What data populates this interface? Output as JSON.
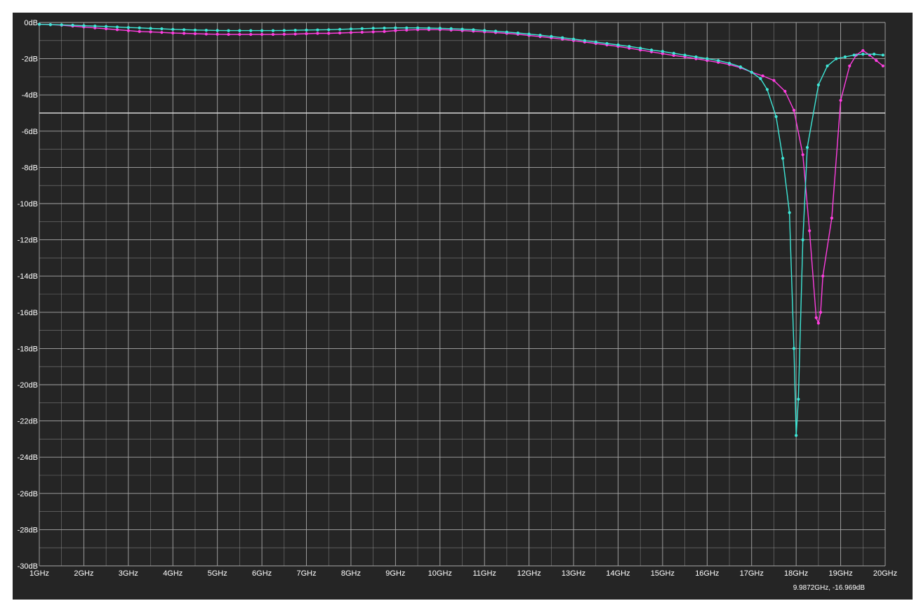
{
  "chart_data": {
    "type": "line",
    "title": "",
    "xlabel": "",
    "ylabel": "",
    "x_unit": "GHz",
    "y_unit": "dB",
    "xlim": [
      1,
      20
    ],
    "ylim": [
      -30,
      0
    ],
    "x_ticks": [
      1,
      2,
      3,
      4,
      5,
      6,
      7,
      8,
      9,
      10,
      11,
      12,
      13,
      14,
      15,
      16,
      17,
      18,
      19,
      20
    ],
    "x_tick_labels": [
      "1GHz",
      "2GHz",
      "3GHz",
      "4GHz",
      "5GHz",
      "6GHz",
      "7GHz",
      "8GHz",
      "9GHz",
      "10GHz",
      "11GHz",
      "12GHz",
      "13GHz",
      "14GHz",
      "15GHz",
      "16GHz",
      "17GHz",
      "18GHz",
      "19GHz",
      "20GHz"
    ],
    "y_ticks": [
      0,
      -2,
      -4,
      -6,
      -8,
      -10,
      -12,
      -14,
      -16,
      -18,
      -20,
      -22,
      -24,
      -26,
      -28,
      -30
    ],
    "y_tick_labels": [
      "0dB",
      "-2dB",
      "-4dB",
      "-6dB",
      "-8dB",
      "-10dB",
      "-12dB",
      "-14dB",
      "-16dB",
      "-18dB",
      "-20dB",
      "-22dB",
      "-24dB",
      "-26dB",
      "-28dB",
      "-30dB"
    ],
    "grid": true,
    "legend": "none",
    "background_color": "#252525",
    "grid_color": "#a8a8a8",
    "cursor_readout": "9.9872GHz, -16.969dB",
    "series": [
      {
        "color": "#ff3ee0",
        "x": [
          1.0,
          1.25,
          1.5,
          1.75,
          2.0,
          2.25,
          2.5,
          2.75,
          3.0,
          3.25,
          3.5,
          3.75,
          4.0,
          4.25,
          4.5,
          4.75,
          5.0,
          5.25,
          5.5,
          5.75,
          6.0,
          6.25,
          6.5,
          6.75,
          7.0,
          7.25,
          7.5,
          7.75,
          8.0,
          8.25,
          8.5,
          8.75,
          9.0,
          9.25,
          9.5,
          9.75,
          10.0,
          10.25,
          10.5,
          10.75,
          11.0,
          11.25,
          11.5,
          11.75,
          12.0,
          12.25,
          12.5,
          12.75,
          13.0,
          13.25,
          13.5,
          13.75,
          14.0,
          14.25,
          14.5,
          14.75,
          15.0,
          15.25,
          15.5,
          15.75,
          16.0,
          16.25,
          16.5,
          16.75,
          17.0,
          17.25,
          17.5,
          17.75,
          17.95,
          18.15,
          18.3,
          18.45,
          18.5,
          18.55,
          18.6,
          18.8,
          19.0,
          19.2,
          19.35,
          19.5,
          19.65,
          19.8,
          19.95
        ],
        "y": [
          -0.1,
          -0.12,
          -0.15,
          -0.2,
          -0.25,
          -0.3,
          -0.35,
          -0.4,
          -0.45,
          -0.5,
          -0.52,
          -0.55,
          -0.58,
          -0.6,
          -0.62,
          -0.64,
          -0.65,
          -0.66,
          -0.66,
          -0.66,
          -0.66,
          -0.66,
          -0.65,
          -0.64,
          -0.62,
          -0.6,
          -0.6,
          -0.58,
          -0.56,
          -0.54,
          -0.52,
          -0.5,
          -0.45,
          -0.42,
          -0.4,
          -0.4,
          -0.4,
          -0.42,
          -0.45,
          -0.48,
          -0.52,
          -0.56,
          -0.6,
          -0.65,
          -0.72,
          -0.78,
          -0.85,
          -0.92,
          -1.0,
          -1.08,
          -1.16,
          -1.24,
          -1.32,
          -1.42,
          -1.52,
          -1.62,
          -1.72,
          -1.82,
          -1.9,
          -2.0,
          -2.1,
          -2.2,
          -2.32,
          -2.5,
          -2.75,
          -2.95,
          -3.2,
          -3.8,
          -4.85,
          -7.3,
          -11.5,
          -16.3,
          -16.6,
          -16.0,
          -14.0,
          -10.8,
          -4.3,
          -2.4,
          -1.8,
          -1.55,
          -1.8,
          -2.1,
          -2.4
        ]
      },
      {
        "color": "#3ee6d6",
        "x": [
          1.0,
          1.25,
          1.5,
          1.75,
          2.0,
          2.25,
          2.5,
          2.75,
          3.0,
          3.25,
          3.5,
          3.75,
          4.0,
          4.25,
          4.5,
          4.75,
          5.0,
          5.25,
          5.5,
          5.75,
          6.0,
          6.25,
          6.5,
          6.75,
          7.0,
          7.25,
          7.5,
          7.75,
          8.0,
          8.25,
          8.5,
          8.75,
          9.0,
          9.25,
          9.5,
          9.75,
          10.0,
          10.25,
          10.5,
          10.75,
          11.0,
          11.25,
          11.5,
          11.75,
          12.0,
          12.25,
          12.5,
          12.75,
          13.0,
          13.25,
          13.5,
          13.75,
          14.0,
          14.25,
          14.5,
          14.75,
          15.0,
          15.25,
          15.5,
          15.75,
          16.0,
          16.25,
          16.5,
          16.75,
          17.0,
          17.2,
          17.35,
          17.55,
          17.7,
          17.85,
          17.95,
          18.0,
          18.05,
          18.15,
          18.25,
          18.5,
          18.7,
          18.9,
          19.1,
          19.3,
          19.5,
          19.75,
          19.95
        ],
        "y": [
          -0.1,
          -0.12,
          -0.13,
          -0.15,
          -0.18,
          -0.2,
          -0.22,
          -0.25,
          -0.28,
          -0.3,
          -0.33,
          -0.35,
          -0.38,
          -0.4,
          -0.42,
          -0.43,
          -0.44,
          -0.45,
          -0.45,
          -0.45,
          -0.45,
          -0.45,
          -0.44,
          -0.43,
          -0.42,
          -0.41,
          -0.4,
          -0.38,
          -0.36,
          -0.34,
          -0.32,
          -0.31,
          -0.3,
          -0.3,
          -0.3,
          -0.31,
          -0.32,
          -0.34,
          -0.37,
          -0.4,
          -0.44,
          -0.48,
          -0.53,
          -0.58,
          -0.64,
          -0.7,
          -0.77,
          -0.84,
          -0.92,
          -1.0,
          -1.08,
          -1.16,
          -1.24,
          -1.32,
          -1.42,
          -1.52,
          -1.6,
          -1.7,
          -1.8,
          -1.9,
          -2.0,
          -2.1,
          -2.25,
          -2.45,
          -2.75,
          -3.1,
          -3.7,
          -5.2,
          -7.5,
          -10.5,
          -18.0,
          -22.8,
          -20.8,
          -12.0,
          -6.9,
          -3.45,
          -2.4,
          -2.0,
          -1.9,
          -1.8,
          -1.75,
          -1.75,
          -1.8
        ]
      }
    ]
  }
}
